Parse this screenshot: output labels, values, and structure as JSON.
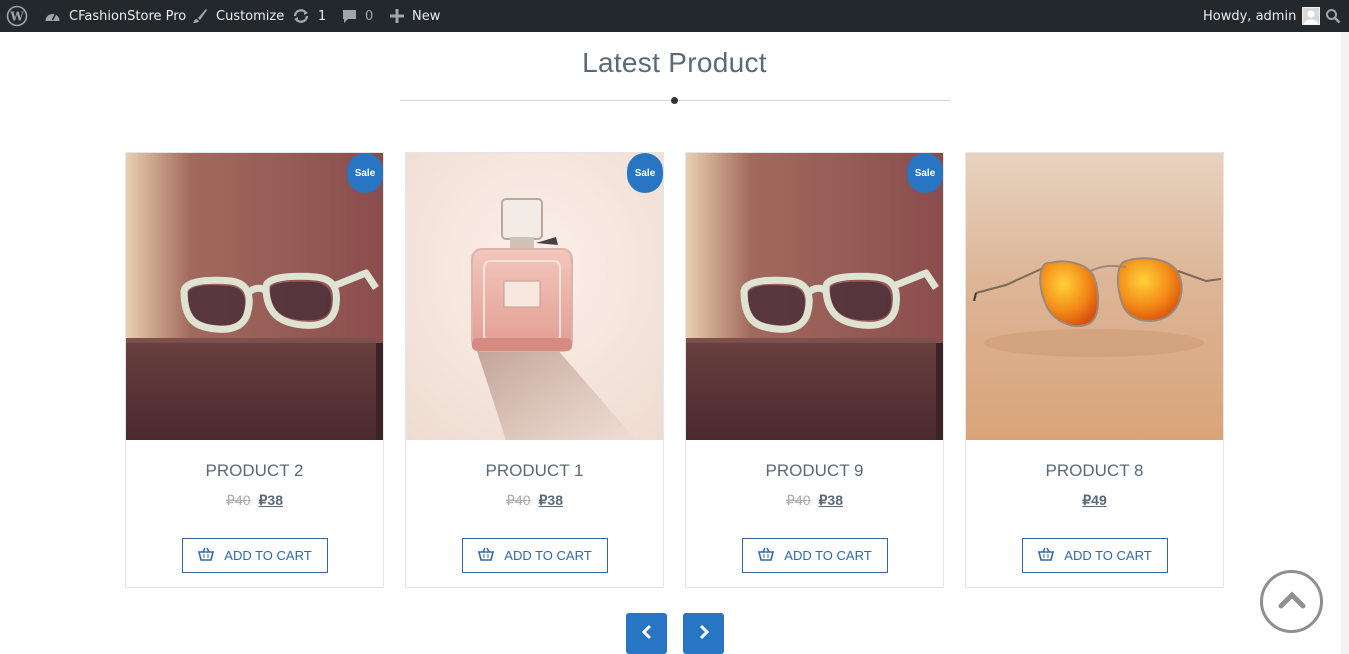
{
  "adminbar": {
    "site_name": "CFashionStore Pro",
    "customize": "Customize",
    "updates_count": "1",
    "comments_count": "0",
    "new_label": "New",
    "greeting": "Howdy, admin"
  },
  "section": {
    "title": "Latest Product"
  },
  "products": [
    {
      "name": "PRODUCT 2",
      "old_price": "₽40",
      "price": "₽38",
      "sale": "Sale",
      "cart_label": "ADD TO CART",
      "image": "white-sunglasses-on-wood"
    },
    {
      "name": "PRODUCT 1",
      "old_price": "₽40",
      "price": "₽38",
      "sale": "Sale",
      "cart_label": "ADD TO CART",
      "image": "perfume-bottle"
    },
    {
      "name": "PRODUCT 9",
      "old_price": "₽40",
      "price": "₽38",
      "sale": "Sale",
      "cart_label": "ADD TO CART",
      "image": "white-sunglasses-on-wood"
    },
    {
      "name": "PRODUCT 8",
      "old_price": "",
      "price": "₽49",
      "sale": "",
      "cart_label": "ADD TO CART",
      "image": "orange-aviators-on-sand"
    }
  ],
  "colors": {
    "adminbar_bg": "#23282d",
    "accent": "#2775c3",
    "title_text": "#5a6a79"
  }
}
